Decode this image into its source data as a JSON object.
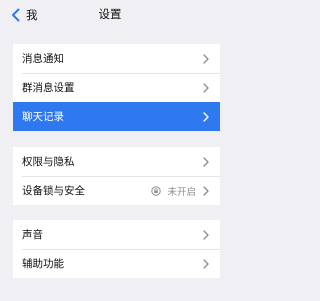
{
  "nav": {
    "back_label": "我",
    "title": "设置"
  },
  "groups": [
    {
      "items": [
        {
          "label": "消息通知"
        },
        {
          "label": "群消息设置"
        },
        {
          "label": "聊天记录",
          "selected": true
        }
      ]
    },
    {
      "items": [
        {
          "label": "权限与隐私"
        },
        {
          "label": "设备锁与安全",
          "value": "未开启",
          "icon": "lock-icon"
        }
      ]
    },
    {
      "items": [
        {
          "label": "声音"
        },
        {
          "label": "辅助功能"
        }
      ]
    }
  ],
  "colors": {
    "accent": "#2f79f0",
    "background": "#efeff4",
    "secondary_text": "#8e8e93"
  }
}
